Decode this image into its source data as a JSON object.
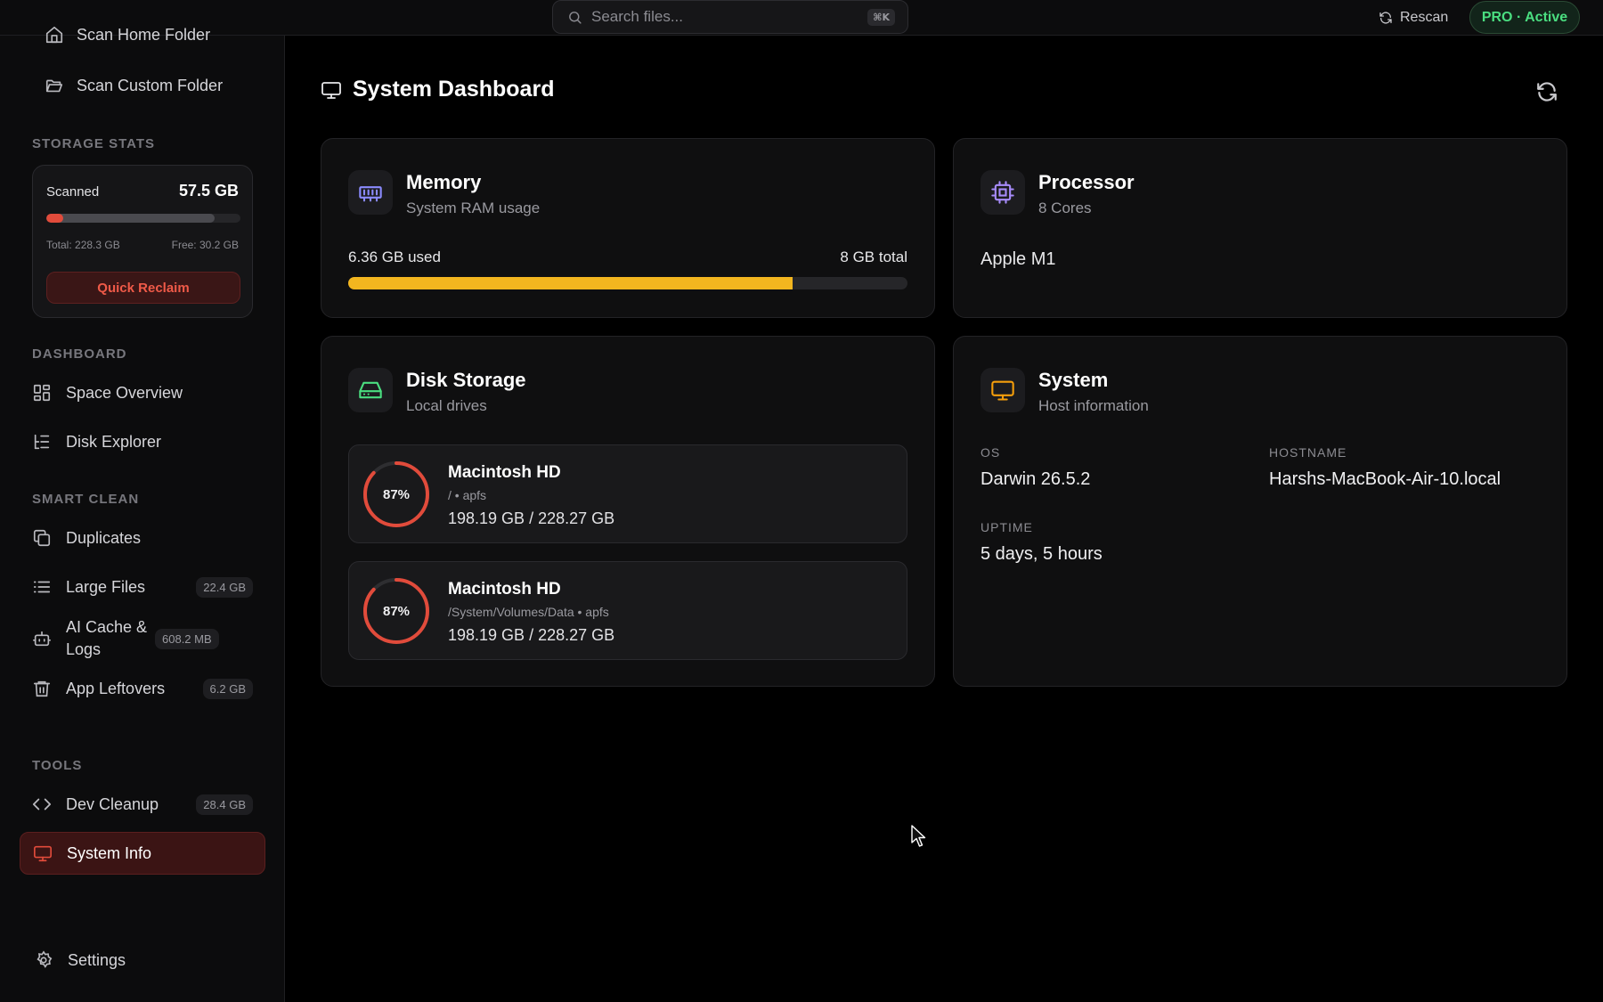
{
  "topbar": {
    "search_placeholder": "Search files...",
    "search_shortcut": "⌘K",
    "rescan_label": "Rescan",
    "plan_badge": "PRO · Active"
  },
  "sidebar": {
    "scan_links": [
      {
        "label": "Scan Home Folder",
        "icon": "home-icon"
      },
      {
        "label": "Scan Custom Folder",
        "icon": "folder-open-icon"
      }
    ],
    "storage_stats": {
      "section_label": "STORAGE STATS",
      "scanned_label": "Scanned",
      "scanned_value": "57.5 GB",
      "total_label": "Total: 228.3 GB",
      "free_label": "Free: 30.2 GB",
      "used_fraction": 0.868,
      "scanned_fraction": 0.089,
      "reclaim_button": "Quick Reclaim"
    },
    "sections": [
      {
        "label": "DASHBOARD",
        "items": [
          {
            "label": "Space Overview",
            "icon": "grid-icon",
            "badge": ""
          },
          {
            "label": "Disk Explorer",
            "icon": "tree-list-icon",
            "badge": ""
          }
        ]
      },
      {
        "label": "SMART CLEAN",
        "items": [
          {
            "label": "Duplicates",
            "icon": "copy-icon",
            "badge": ""
          },
          {
            "label": "Large Files",
            "icon": "list-icon",
            "badge": "22.4 GB"
          },
          {
            "label": "AI Cache & Logs",
            "icon": "bot-icon",
            "badge": "608.2 MB"
          },
          {
            "label": "App Leftovers",
            "icon": "trash-icon",
            "badge": "6.2 GB"
          }
        ]
      },
      {
        "label": "TOOLS",
        "items": [
          {
            "label": "Dev Cleanup",
            "icon": "code-icon",
            "badge": "28.4 GB"
          },
          {
            "label": "System Info",
            "icon": "monitor-icon",
            "badge": "",
            "active": true
          }
        ]
      }
    ],
    "settings_label": "Settings"
  },
  "main": {
    "title": "System Dashboard",
    "memory": {
      "title": "Memory",
      "subtitle": "System RAM usage",
      "used_label": "6.36 GB used",
      "total_label": "8 GB total",
      "used_fraction": 0.795,
      "icon": "memory-chip-icon",
      "bar_color": "#f3b61f"
    },
    "processor": {
      "title": "Processor",
      "subtitle": "8 Cores",
      "model": "Apple M1",
      "icon": "cpu-icon"
    },
    "disk": {
      "title": "Disk Storage",
      "subtitle": "Local drives",
      "icon": "hard-drive-icon",
      "drives": [
        {
          "name": "Macintosh HD",
          "meta": "/ • apfs",
          "size": "198.19 GB / 228.27 GB",
          "percent_label": "87%",
          "percent": 87
        },
        {
          "name": "Macintosh HD",
          "meta": "/System/Volumes/Data • apfs",
          "size": "198.19 GB / 228.27 GB",
          "percent_label": "87%",
          "percent": 87
        }
      ],
      "ring_color": "#e14b3b"
    },
    "system": {
      "title": "System",
      "subtitle": "Host information",
      "icon": "monitor-icon",
      "os_label": "OS",
      "os_value": "Darwin 26.5.2",
      "hostname_label": "HOSTNAME",
      "hostname_value": "Harshs-MacBook-Air-10.local",
      "uptime_label": "UPTIME",
      "uptime_value": "5 days, 5 hours"
    }
  },
  "colors": {
    "accent_red": "#e14b3b",
    "accent_green": "#4ade80",
    "memory_yellow": "#f3b61f",
    "memory_icon": "#8b8bff",
    "cpu_icon": "#a78bfa",
    "disk_icon": "#4ade80",
    "system_icon": "#f59e0b"
  }
}
